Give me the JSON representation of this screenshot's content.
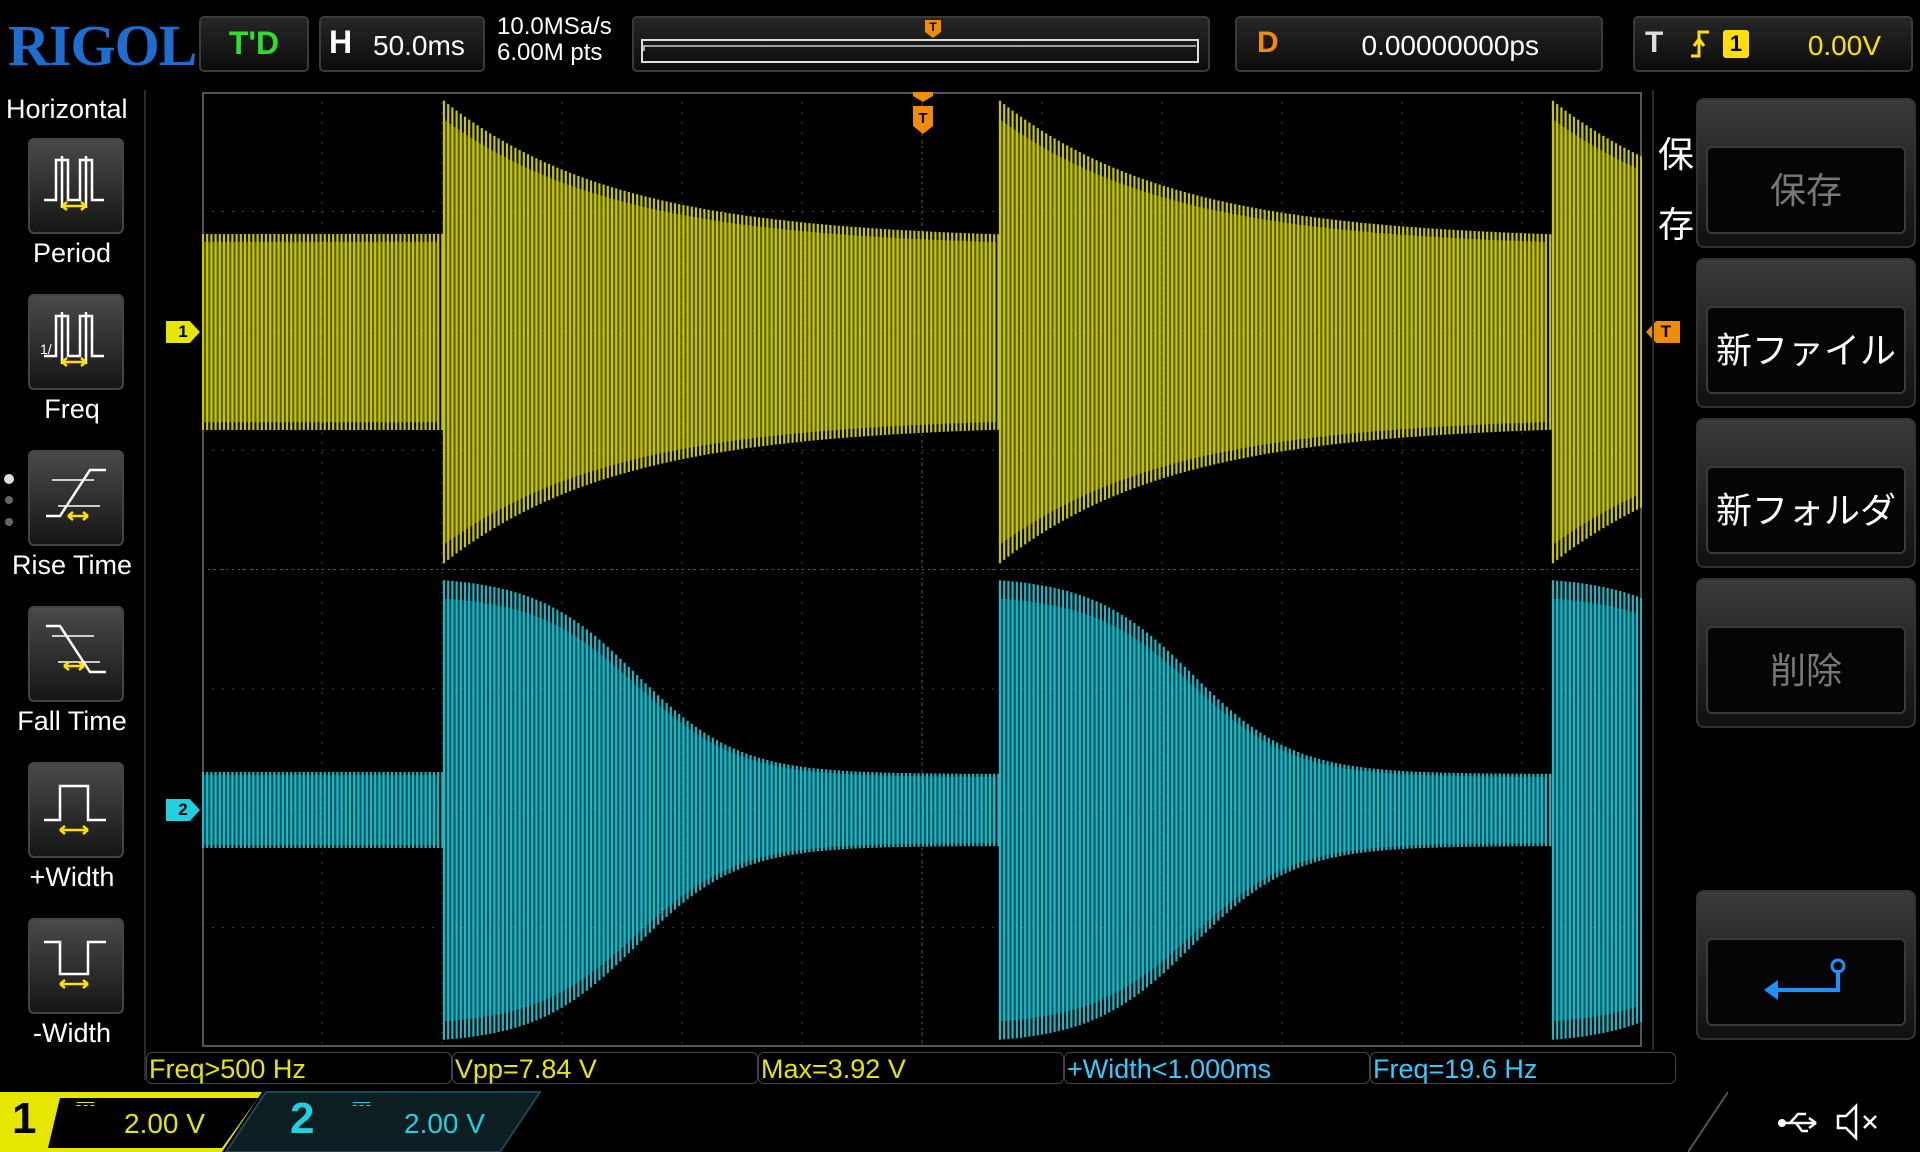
{
  "brand": "RIGOL",
  "top": {
    "run_state": "T'D",
    "timebase_key": "H",
    "timebase_value": "50.0ms",
    "sample_rate": "10.0MSa/s",
    "memory_depth": "6.00M pts",
    "trigger_position_marker": "T",
    "delay_key": "D",
    "delay_value": "0.00000000ps",
    "trigger_key": "T",
    "trigger_slope_icon": "rising-edge-icon",
    "trigger_source": "1",
    "trigger_level": "0.00V"
  },
  "left_panel": {
    "title": "Horizontal",
    "items": [
      {
        "label": "Period",
        "icon": "period-icon",
        "selected": false
      },
      {
        "label": "Freq",
        "icon": "freq-icon",
        "selected": false
      },
      {
        "label": "Rise Time",
        "icon": "rise-time-icon",
        "selected": false
      },
      {
        "label": "Fall Time",
        "icon": "fall-time-icon",
        "selected": false
      },
      {
        "label": "+Width",
        "icon": "positive-width-icon",
        "selected": false
      },
      {
        "label": "-Width",
        "icon": "negative-width-icon",
        "selected": false
      }
    ]
  },
  "right_panel": {
    "title_line1": "保",
    "title_line2": "存",
    "softkeys": [
      {
        "label": "保存",
        "enabled": false
      },
      {
        "label": "新ファイル",
        "enabled": true
      },
      {
        "label": "新フォルダ",
        "enabled": true
      },
      {
        "label": "削除",
        "enabled": false
      }
    ],
    "back_icon": "return-arrow-icon"
  },
  "markers": {
    "ch1": "1",
    "ch2": "2",
    "trigger_level": "T",
    "trigger_time": "T"
  },
  "measurements": [
    {
      "text": "Freq>500 Hz",
      "color": "#e6e600"
    },
    {
      "text": "Vpp=7.84 V",
      "color": "#e6e600"
    },
    {
      "text": "Max=3.92 V",
      "color": "#e6e600"
    },
    {
      "text": "+Width<1.000ms",
      "color": "#33ccff"
    },
    {
      "text": "Freq=19.6 Hz",
      "color": "#33ccff"
    }
  ],
  "channels": [
    {
      "number": "1",
      "coupling_icon": "dc-coupling-icon",
      "scale": "2.00 V",
      "color": "#e6e600"
    },
    {
      "number": "2",
      "coupling_icon": "dc-coupling-icon",
      "scale": "2.00 V",
      "color": "#20d0e0"
    }
  ],
  "status_icons": [
    "usb-icon",
    "sound-muted-icon"
  ],
  "colors": {
    "ch1": "#c8c800",
    "ch2": "#19b9c8",
    "trigger": "#f08c00",
    "brand": "#1e6ed2"
  }
}
